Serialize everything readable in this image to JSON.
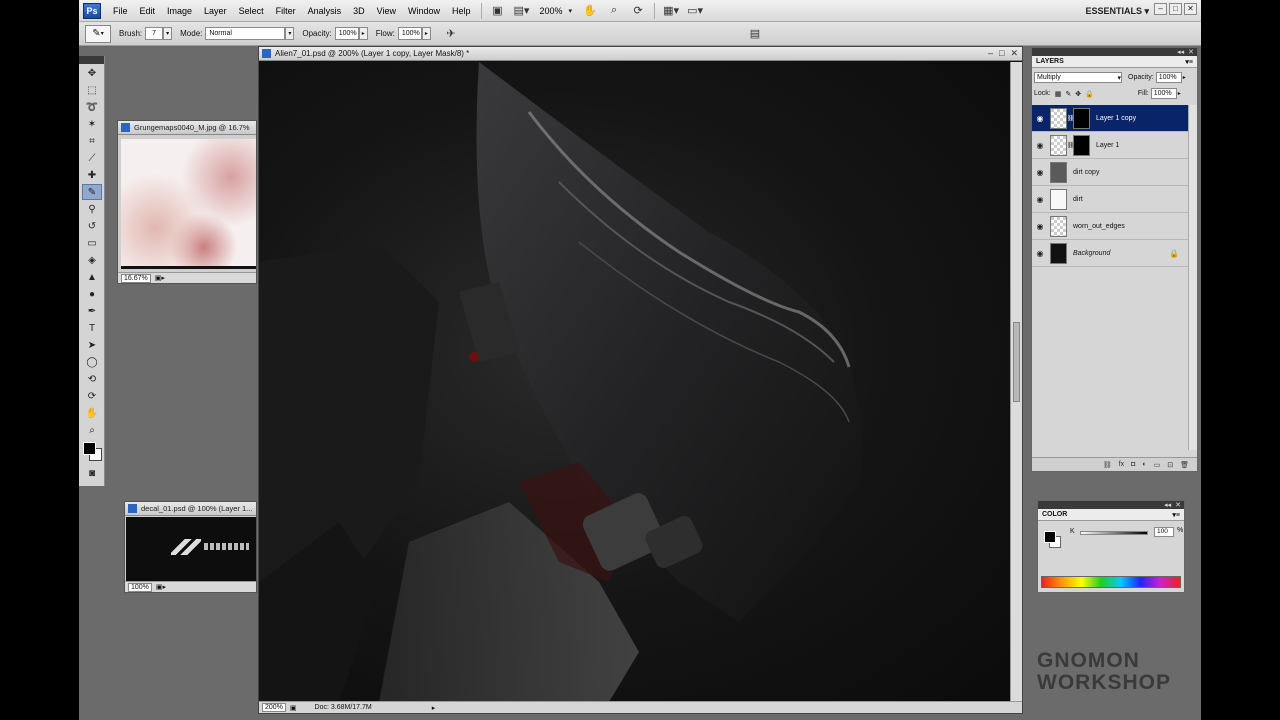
{
  "app": {
    "logo": "Ps",
    "workspace": "ESSENTIALS",
    "zoom_display": "200%"
  },
  "menu": [
    "File",
    "Edit",
    "Image",
    "Layer",
    "Select",
    "Filter",
    "Analysis",
    "3D",
    "View",
    "Window",
    "Help"
  ],
  "options_bar": {
    "brush_label": "Brush:",
    "brush_size": "7",
    "mode_label": "Mode:",
    "mode_value": "Normal",
    "opacity_label": "Opacity:",
    "opacity_value": "100%",
    "flow_label": "Flow:",
    "flow_value": "100%"
  },
  "documents": {
    "grunge": {
      "title": "Grungemaps0040_M.jpg @ 16.7%",
      "zoom": "16.67%"
    },
    "decal": {
      "title": "decal_01.psd @ 100% (Layer 1...",
      "zoom": "100%"
    },
    "main": {
      "title": "Alien7_01.psd @ 200% (Layer 1 copy, Layer Mask/8) *",
      "zoom": "200%",
      "doc_info": "Doc: 3.68M/17.7M"
    }
  },
  "layers_panel": {
    "tab": "LAYERS",
    "blend_mode": "Multiply",
    "opacity_label": "Opacity:",
    "opacity_value": "100%",
    "lock_label": "Lock:",
    "fill_label": "Fill:",
    "fill_value": "100%",
    "layers": [
      {
        "name": "Layer 1 copy",
        "selected": true
      },
      {
        "name": "Layer 1"
      },
      {
        "name": "dirt copy"
      },
      {
        "name": "dirt"
      },
      {
        "name": "worn_out_edges"
      },
      {
        "name": "Background"
      }
    ]
  },
  "color_panel": {
    "tab": "COLOR",
    "channel": "K",
    "value": "100",
    "unit": "%"
  },
  "watermark": {
    "line1": "GNOMON",
    "line2": "WORKSHOP"
  }
}
